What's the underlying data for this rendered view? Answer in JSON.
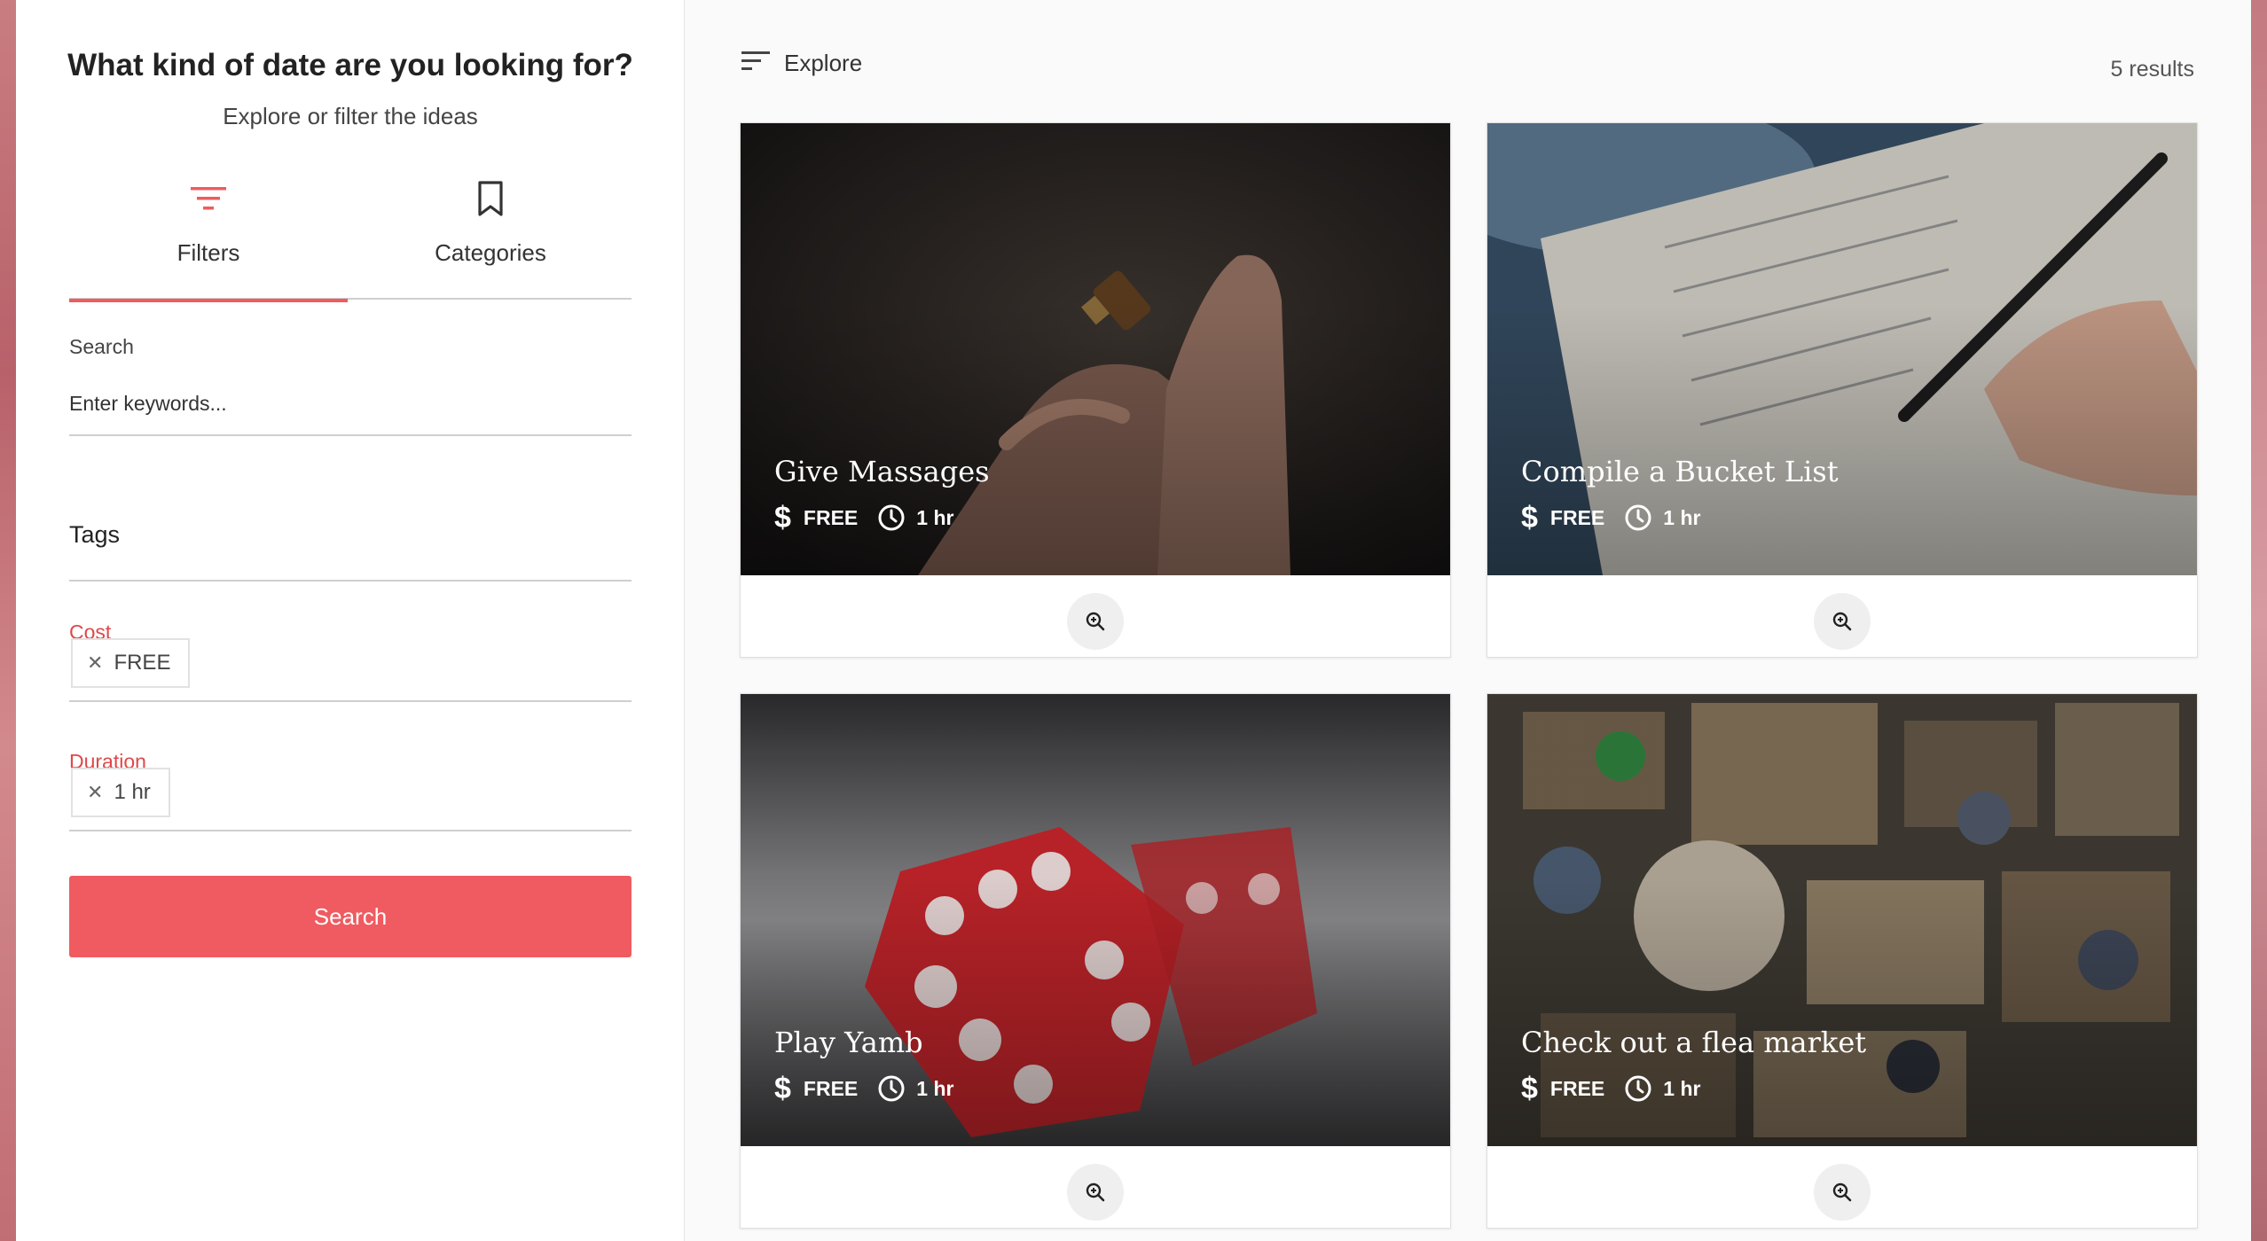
{
  "sidebar": {
    "title": "What kind of date are you looking for?",
    "subtitle": "Explore or filter the ideas",
    "tabs": [
      {
        "label": "Filters",
        "icon": "filter-icon",
        "active": true
      },
      {
        "label": "Categories",
        "icon": "bookmark-icon",
        "active": false
      }
    ],
    "search": {
      "label": "Search",
      "placeholder": "Enter keywords...",
      "value": ""
    },
    "tags": {
      "label": "Tags"
    },
    "cost": {
      "label": "Cost",
      "chip": "FREE"
    },
    "duration": {
      "label": "Duration",
      "chip": "1 hr"
    },
    "search_button": "Search"
  },
  "main": {
    "explore_label": "Explore",
    "results_count": "5 results",
    "cards": [
      {
        "title": "Give Massages",
        "cost": "FREE",
        "duration": "1 hr"
      },
      {
        "title": "Compile a Bucket List",
        "cost": "FREE",
        "duration": "1 hr"
      },
      {
        "title": "Play Yamb",
        "cost": "FREE",
        "duration": "1 hr"
      },
      {
        "title": "Check out a flea market",
        "cost": "FREE",
        "duration": "1 hr"
      }
    ]
  },
  "colors": {
    "accent": "#ef5b60",
    "active_tab": "#ef5b5e",
    "label_red": "#e0474a"
  }
}
